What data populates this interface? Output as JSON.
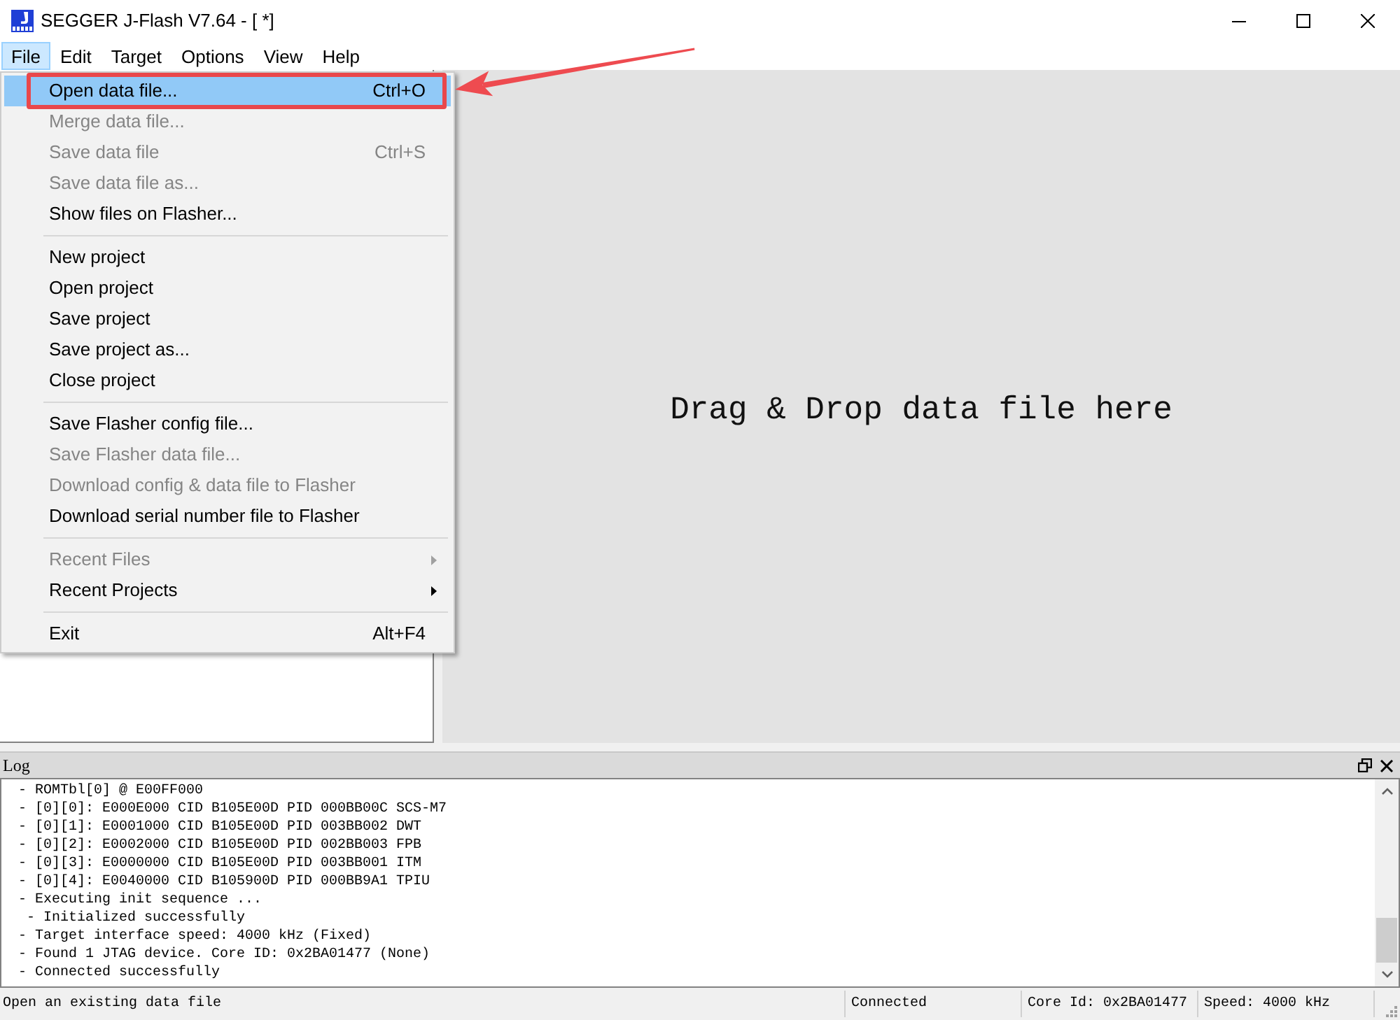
{
  "window": {
    "title": "SEGGER J-Flash V7.64 - [ *]"
  },
  "menu_bar": [
    {
      "label": "File",
      "selected": true
    },
    {
      "label": "Edit",
      "selected": false
    },
    {
      "label": "Target",
      "selected": false
    },
    {
      "label": "Options",
      "selected": false
    },
    {
      "label": "View",
      "selected": false
    },
    {
      "label": "Help",
      "selected": false
    }
  ],
  "file_menu": {
    "items": [
      {
        "kind": "item",
        "label": "Open data file...",
        "shortcut": "Ctrl+O",
        "disabled": false,
        "selected": true,
        "annotated": true
      },
      {
        "kind": "item",
        "label": "Merge data file...",
        "disabled": true,
        "selected": false,
        "annotated": false
      },
      {
        "kind": "item",
        "label": "Save data file",
        "shortcut": "Ctrl+S",
        "disabled": true,
        "selected": false,
        "annotated": false
      },
      {
        "kind": "item",
        "label": "Save data file as...",
        "disabled": true,
        "selected": false,
        "annotated": false
      },
      {
        "kind": "item",
        "label": "Show files on Flasher...",
        "disabled": false,
        "selected": false,
        "annotated": false
      },
      {
        "kind": "separator"
      },
      {
        "kind": "item",
        "label": "New project",
        "disabled": false,
        "selected": false,
        "annotated": false
      },
      {
        "kind": "item",
        "label": "Open project",
        "disabled": false,
        "selected": false,
        "annotated": false
      },
      {
        "kind": "item",
        "label": "Save project",
        "disabled": false,
        "selected": false,
        "annotated": false
      },
      {
        "kind": "item",
        "label": "Save project as...",
        "disabled": false,
        "selected": false,
        "annotated": false
      },
      {
        "kind": "item",
        "label": "Close project",
        "disabled": false,
        "selected": false,
        "annotated": false
      },
      {
        "kind": "separator"
      },
      {
        "kind": "item",
        "label": "Save Flasher config file...",
        "disabled": false,
        "selected": false,
        "annotated": false
      },
      {
        "kind": "item",
        "label": "Save Flasher data file...",
        "disabled": true,
        "selected": false,
        "annotated": false
      },
      {
        "kind": "item",
        "label": "Download config & data file to Flasher",
        "disabled": true,
        "selected": false,
        "annotated": false
      },
      {
        "kind": "item",
        "label": "Download serial number file to Flasher",
        "disabled": false,
        "selected": false,
        "annotated": false
      },
      {
        "kind": "separator"
      },
      {
        "kind": "submenu",
        "label": "Recent Files",
        "disabled": true,
        "selected": false,
        "annotated": false
      },
      {
        "kind": "submenu",
        "label": "Recent Projects",
        "disabled": false,
        "selected": false,
        "annotated": false
      },
      {
        "kind": "separator"
      },
      {
        "kind": "item",
        "label": "Exit",
        "shortcut": "Alt+F4",
        "disabled": false,
        "selected": false,
        "annotated": false
      }
    ]
  },
  "drop_area": {
    "text": "Drag & Drop data file here"
  },
  "log": {
    "title": "Log",
    "lines": [
      {
        "text": "- ROMTbl[0] @ E00FF000"
      },
      {
        "text": "- [0][0]: E000E000 CID B105E00D PID 000BB00C SCS-M7"
      },
      {
        "text": "- [0][1]: E0001000 CID B105E00D PID 003BB002 DWT"
      },
      {
        "text": "- [0][2]: E0002000 CID B105E00D PID 002BB003 FPB"
      },
      {
        "text": "- [0][3]: E0000000 CID B105E00D PID 003BB001 ITM"
      },
      {
        "text": "- [0][4]: E0040000 CID B105900D PID 000BB9A1 TPIU"
      },
      {
        "text": "- Executing init sequence ...",
        "children": [
          {
            "text": "- Initialized successfully"
          }
        ]
      },
      {
        "text": "- Target interface speed: 4000 kHz (Fixed)"
      },
      {
        "text": "- Found 1 JTAG device. Core ID: 0x2BA01477 (None)"
      },
      {
        "text": "- Connected successfully"
      }
    ]
  },
  "status_bar": {
    "message": "Open an existing data file",
    "fields": [
      "Connected",
      "Core Id: 0x2BA01477",
      "Speed: 4000 kHz"
    ]
  }
}
